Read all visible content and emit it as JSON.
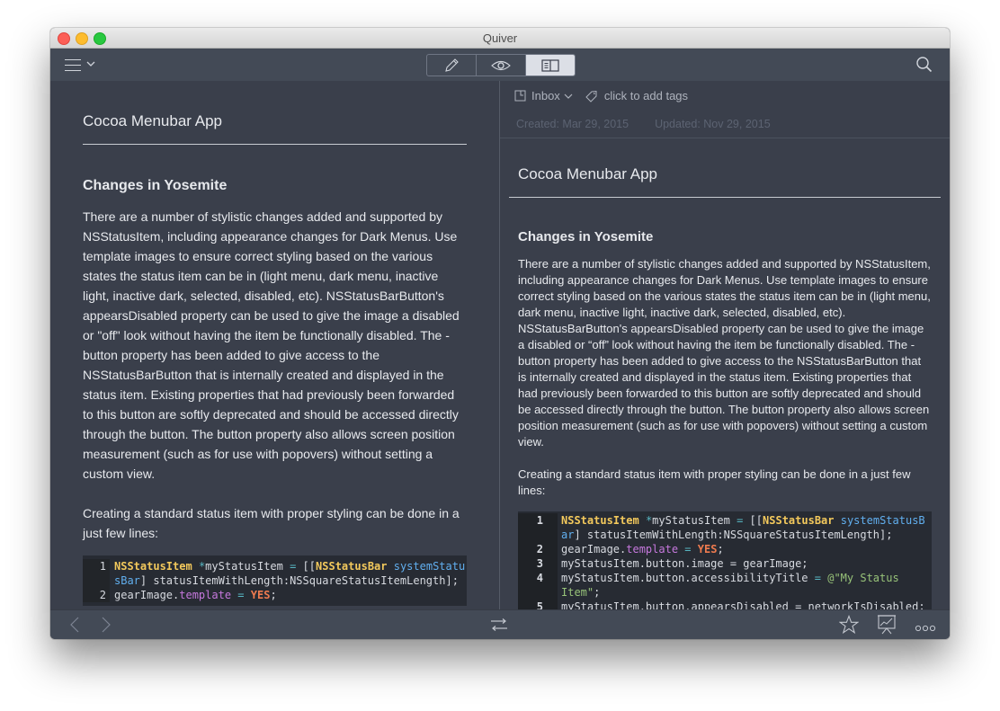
{
  "window": {
    "title": "Quiver"
  },
  "toolbar": {
    "menu_icon": "hamburger-icon",
    "view_modes": [
      {
        "name": "edit",
        "icon": "pencil-icon",
        "active": false
      },
      {
        "name": "preview",
        "icon": "eye-icon",
        "active": false
      },
      {
        "name": "split",
        "icon": "split-view-icon",
        "active": true
      }
    ],
    "search_icon": "search-icon"
  },
  "editor": {
    "title": "Cocoa Menubar App",
    "heading": "Changes in Yosemite",
    "paragraph1": "There are a number of stylistic changes added and supported by NSStatusItem, including appearance changes for Dark Menus. Use template images to ensure correct styling based on the various states the status item can be in (light menu, dark menu, inactive light, inactive dark, selected, disabled, etc). NSStatusBarButton's appearsDisabled property can be used to give the image a disabled or \"off\" look without having the item be functionally disabled. The -button property has been added to give access to the NSStatusBarButton that is internally created and displayed in the status item. Existing properties that had previously been forwarded to this button are softly deprecated and should be accessed directly through the button. The button property also allows screen position measurement (such as for use with popovers) without setting a custom view.",
    "paragraph2": "Creating a standard status item with proper styling can be done in a just few lines:",
    "code_lines": [
      {
        "num": "1",
        "text": "NSStatusItem *myStatusItem = [[NSStatusBar systemStatusBar] statusItemWithLength:NSSquareStatusItemLength];"
      },
      {
        "num": "2",
        "text": "gearImage.template = YES;"
      }
    ]
  },
  "preview": {
    "notebook": "Inbox",
    "tags_placeholder": "click to add tags",
    "created": "Created: Mar 29, 2015",
    "updated": "Updated: Nov 29, 2015",
    "title": "Cocoa Menubar App",
    "heading": "Changes in Yosemite",
    "paragraph1": "There are a number of stylistic changes added and supported by NSStatusItem, including appearance changes for Dark Menus. Use template images to ensure correct styling based on the various states the status item can be in (light menu, dark menu, inactive light, inactive dark, selected, disabled, etc). NSStatusBarButton's appearsDisabled property can be used to give the image a disabled or “off” look without having the item be functionally disabled. The -button property has been added to give access to the NSStatusBarButton that is internally created and displayed in the status item. Existing properties that had previously been forwarded to this button are softly deprecated and should be accessed directly through the button. The button property also allows screen position measurement (such as for use with popovers) without setting a custom view.",
    "paragraph2": "Creating a standard status item with proper styling can be done in a just few lines:",
    "code_lines": [
      {
        "num": "1",
        "text": "NSStatusItem *myStatusItem = [[NSStatusBar systemStatusBar] statusItemWithLength:NSSquareStatusItemLength];"
      },
      {
        "num": "2",
        "text": "gearImage.template = YES;"
      },
      {
        "num": "3",
        "text": "myStatusItem.button.image = gearImage;"
      },
      {
        "num": "4",
        "text": "myStatusItem.button.accessibilityTitle = @\"My Status Item\";"
      },
      {
        "num": "5",
        "text": "myStatusItem.button.appearsDisabled = networkIsDisabled;"
      }
    ]
  },
  "bottombar": {
    "back_icon": "chevron-left-icon",
    "forward_icon": "chevron-right-icon",
    "swap_icon": "swap-arrows-icon",
    "star_icon": "star-icon",
    "presentation_icon": "presentation-icon",
    "more_icon": "more-icon"
  },
  "colors": {
    "background": "#3a3f4b",
    "toolbar": "#434a56",
    "code_background": "#272b33",
    "code_type": "#f3c95c",
    "code_selector": "#61afef",
    "code_property": "#c678dd",
    "code_keyword": "#ef7b4f",
    "code_string": "#98c379"
  }
}
